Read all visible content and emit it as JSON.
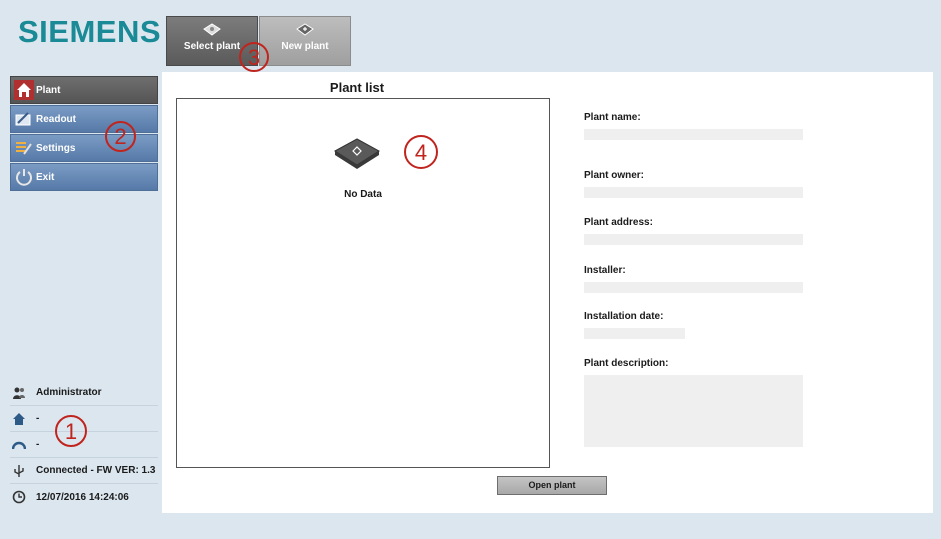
{
  "brand": {
    "logo_text": "SIEMENS",
    "color": "#1a8a96"
  },
  "top_buttons": [
    {
      "label": "Select plant",
      "icon": "folder-icon"
    },
    {
      "label": "New plant",
      "icon": "new-folder-icon"
    }
  ],
  "sidebar": {
    "items": [
      {
        "label": "Plant",
        "icon": "home-icon",
        "active": true
      },
      {
        "label": "Readout",
        "icon": "meter-readout-icon"
      },
      {
        "label": "Settings",
        "icon": "settings-tools-icon"
      },
      {
        "label": "Exit",
        "icon": "power-icon"
      }
    ]
  },
  "status": {
    "user": "Administrator",
    "plant": "-",
    "meter": "-",
    "connection": "Connected - FW VER: 1.3",
    "datetime": "12/07/2016 14:24:06"
  },
  "plant_list": {
    "title": "Plant list",
    "empty_text": "No Data"
  },
  "details": {
    "plant_name_label": "Plant name:",
    "plant_owner_label": "Plant owner:",
    "plant_address_label": "Plant address:",
    "installer_label": "Installer:",
    "installation_date_label": "Installation date:",
    "plant_description_label": "Plant description:"
  },
  "open_button_label": "Open plant",
  "callouts": [
    "3",
    "2",
    "4",
    "1"
  ],
  "colors": {
    "nav_blue": "#5679a8",
    "active_gray": "#5a5a5a",
    "callout_red": "#c0241d"
  }
}
